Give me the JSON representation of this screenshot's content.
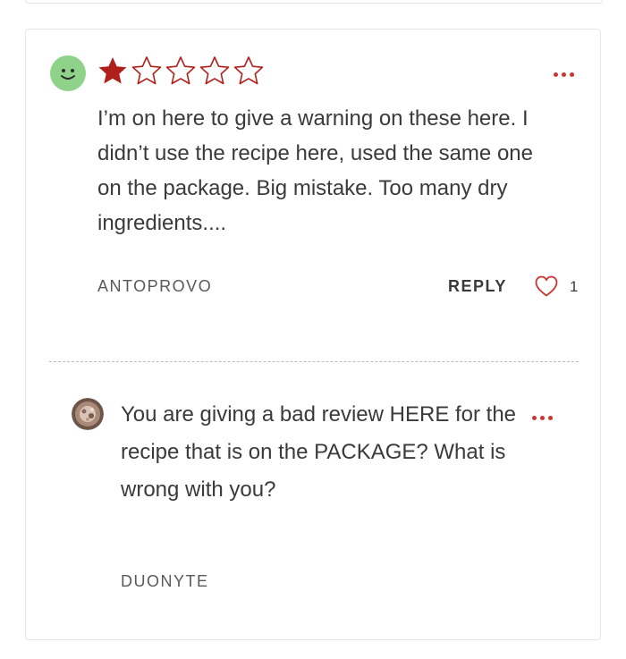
{
  "colors": {
    "accent": "#c8362f",
    "avatar_green": "#8fd38a",
    "text": "#3a3a3a",
    "muted": "#595959"
  },
  "review": {
    "rating": 1,
    "max_rating": 5,
    "text": "I’m on here to give a warning on these here. I didn’t use the recipe here, used the same one on the package. Big mistake. Too many dry ingredients....",
    "username": "ANTOPROVO",
    "reply_label": "REPLY",
    "like_count": "1",
    "avatar_icon": "smiley-face-icon",
    "more_icon": "more-options-icon"
  },
  "reply": {
    "text": "You are giving a bad review HERE for the recipe that is on the PACKAGE? What is wrong with you?",
    "username": "DUONYTE",
    "avatar_icon": "user-photo-avatar",
    "more_icon": "more-options-icon"
  }
}
